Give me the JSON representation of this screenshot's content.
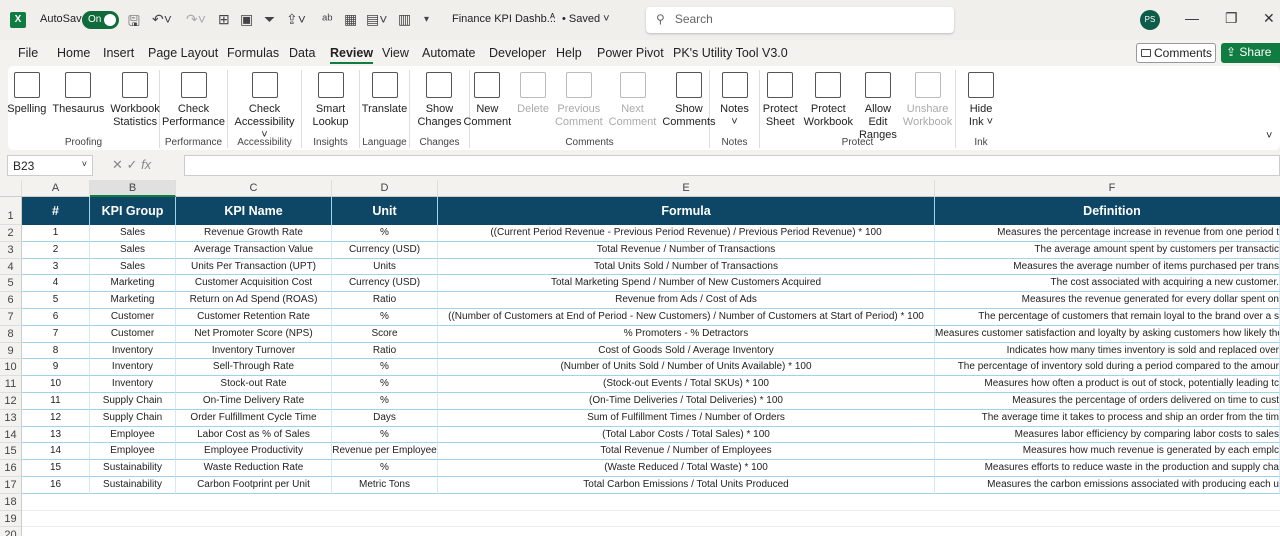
{
  "titlebar": {
    "autosave": "AutoSave",
    "toggle": "On",
    "doc_title": "Finance KPI Dashb...",
    "saved": "• Saved",
    "search_placeholder": "Search",
    "avatar": "PS"
  },
  "tabs": [
    "File",
    "Home",
    "Insert",
    "Page Layout",
    "Formulas",
    "Data",
    "Review",
    "View",
    "Automate",
    "Developer",
    "Help",
    "Power Pivot",
    "PK's Utility Tool V3.0"
  ],
  "active_tab": "Review",
  "buttons": {
    "comments": "Comments",
    "share": "Share"
  },
  "ribbon": [
    {
      "group": "Proofing",
      "buttons": [
        {
          "l1": "Spelling",
          "l2": "",
          "icon": "spelling-icon"
        },
        {
          "l1": "Thesaurus",
          "l2": "",
          "icon": "thesaurus-icon"
        },
        {
          "l1": "Workbook",
          "l2": "Statistics",
          "icon": "workbook-statistics-icon"
        }
      ]
    },
    {
      "group": "Performance",
      "buttons": [
        {
          "l1": "Check",
          "l2": "Performance",
          "icon": "check-performance-icon"
        }
      ]
    },
    {
      "group": "Accessibility",
      "buttons": [
        {
          "l1": "Check",
          "l2": "Accessibility ˅",
          "icon": "check-accessibility-icon"
        }
      ]
    },
    {
      "group": "Insights",
      "buttons": [
        {
          "l1": "Smart",
          "l2": "Lookup",
          "icon": "smart-lookup-icon"
        }
      ]
    },
    {
      "group": "Language",
      "buttons": [
        {
          "l1": "Translate",
          "l2": "",
          "icon": "translate-icon"
        }
      ]
    },
    {
      "group": "Changes",
      "buttons": [
        {
          "l1": "Show",
          "l2": "Changes",
          "icon": "show-changes-icon"
        }
      ]
    },
    {
      "group": "Comments",
      "buttons": [
        {
          "l1": "New",
          "l2": "Comment",
          "icon": "new-comment-icon"
        },
        {
          "l1": "Delete",
          "l2": "",
          "icon": "delete-comment-icon",
          "disabled": true
        },
        {
          "l1": "Previous",
          "l2": "Comment",
          "icon": "previous-comment-icon",
          "disabled": true
        },
        {
          "l1": "Next",
          "l2": "Comment",
          "icon": "next-comment-icon",
          "disabled": true
        },
        {
          "l1": "Show",
          "l2": "Comments",
          "icon": "show-comments-icon"
        }
      ]
    },
    {
      "group": "Notes",
      "buttons": [
        {
          "l1": "Notes",
          "l2": "˅",
          "icon": "notes-icon"
        }
      ]
    },
    {
      "group": "Protect",
      "buttons": [
        {
          "l1": "Protect",
          "l2": "Sheet",
          "icon": "protect-sheet-icon"
        },
        {
          "l1": "Protect",
          "l2": "Workbook",
          "icon": "protect-workbook-icon"
        },
        {
          "l1": "Allow Edit",
          "l2": "Ranges",
          "icon": "allow-edit-ranges-icon"
        },
        {
          "l1": "Unshare",
          "l2": "Workbook",
          "icon": "unshare-workbook-icon",
          "disabled": true
        }
      ]
    },
    {
      "group": "Ink",
      "buttons": [
        {
          "l1": "Hide",
          "l2": "Ink ˅",
          "icon": "hide-ink-icon"
        }
      ]
    }
  ],
  "formula_bar": {
    "name_box": "B23",
    "fx": "fx",
    "value": ""
  },
  "columns": [
    "A",
    "B",
    "C",
    "D",
    "E",
    "F"
  ],
  "selected_column": "B",
  "table": {
    "headers": [
      "#",
      "KPI Group",
      "KPI Name",
      "Unit",
      "Formula",
      "Definition"
    ],
    "rows": [
      [
        "1",
        "Sales",
        "Revenue Growth Rate",
        "%",
        "((Current Period Revenue - Previous Period Revenue) / Previous Period Revenue) * 100",
        "Measures the percentage increase in revenue from one period t"
      ],
      [
        "2",
        "Sales",
        "Average Transaction Value",
        "Currency (USD)",
        "Total Revenue / Number of Transactions",
        "The average amount spent by customers per transactic"
      ],
      [
        "3",
        "Sales",
        "Units Per Transaction (UPT)",
        "Units",
        "Total Units Sold / Number of Transactions",
        "Measures the average number of items purchased per trans"
      ],
      [
        "4",
        "Marketing",
        "Customer Acquisition Cost",
        "Currency (USD)",
        "Total Marketing Spend / Number of New Customers Acquired",
        "The cost associated with acquiring a new customer."
      ],
      [
        "5",
        "Marketing",
        "Return on Ad Spend (ROAS)",
        "Ratio",
        "Revenue from Ads / Cost of Ads",
        "Measures the revenue generated for every dollar spent on"
      ],
      [
        "6",
        "Customer",
        "Customer Retention Rate",
        "%",
        "((Number of Customers at End of Period - New Customers) / Number of Customers at Start of Period) * 100",
        "The percentage of customers that remain loyal to the brand over a s"
      ],
      [
        "7",
        "Customer",
        "Net Promoter Score (NPS)",
        "Score",
        "% Promoters - % Detractors",
        "Measures customer satisfaction and loyalty by asking customers how likely they a"
      ],
      [
        "8",
        "Inventory",
        "Inventory Turnover",
        "Ratio",
        "Cost of Goods Sold / Average Inventory",
        "Indicates how many times inventory is sold and replaced over"
      ],
      [
        "9",
        "Inventory",
        "Sell-Through Rate",
        "%",
        "(Number of Units Sold / Number of Units Available) * 100",
        "The percentage of inventory sold during a period compared to the amour"
      ],
      [
        "10",
        "Inventory",
        "Stock-out Rate",
        "%",
        "(Stock-out Events / Total SKUs) * 100",
        "Measures how often a product is out of stock, potentially leading tc"
      ],
      [
        "11",
        "Supply Chain",
        "On-Time Delivery Rate",
        "%",
        "(On-Time Deliveries / Total Deliveries) * 100",
        "Measures the percentage of orders delivered on time to cust"
      ],
      [
        "12",
        "Supply Chain",
        "Order Fulfillment Cycle Time",
        "Days",
        "Sum of Fulfillment Times / Number of Orders",
        "The average time it takes to process and ship an order from the tim"
      ],
      [
        "13",
        "Employee",
        "Labor Cost as % of Sales",
        "%",
        "(Total Labor Costs / Total Sales) * 100",
        "Measures labor efficiency by comparing labor costs to sales"
      ],
      [
        "14",
        "Employee",
        "Employee Productivity",
        "Revenue per Employee",
        "Total Revenue / Number of Employees",
        "Measures how much revenue is generated by each emplc"
      ],
      [
        "15",
        "Sustainability",
        "Waste Reduction Rate",
        "%",
        "(Waste Reduced / Total Waste) * 100",
        "Measures efforts to reduce waste in the production and supply cha"
      ],
      [
        "16",
        "Sustainability",
        "Carbon Footprint per Unit",
        "Metric Tons",
        "Total Carbon Emissions / Total Units Produced",
        "Measures the carbon emissions associated with producing each u"
      ]
    ]
  },
  "colors": {
    "header_bg": "#0e4766",
    "accent": "#107c41",
    "row_border": "#9fd3e8"
  }
}
